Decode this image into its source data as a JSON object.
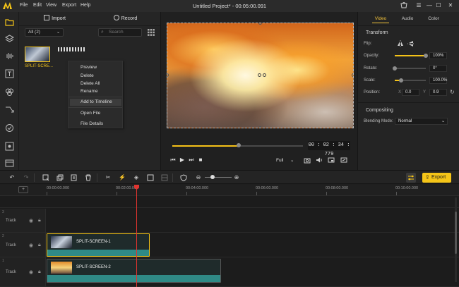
{
  "app": {
    "title": "Untitled Project* - 00:05:00.091",
    "menu": [
      "File",
      "Edit",
      "View",
      "Export",
      "Help"
    ]
  },
  "media_panel": {
    "import_label": "Import",
    "record_label": "Record",
    "filter_value": "All (2)",
    "search_placeholder": "Search",
    "item_label": "SPLIT-SCRE...",
    "context_menu": [
      "Preview",
      "Delete",
      "Delete All",
      "Rename",
      "Add to Timeline",
      "Open File",
      "File Details"
    ],
    "context_menu_highlight": "Add to Timeline"
  },
  "preview": {
    "timecode": "00 : 02 : 34 : 779",
    "progress": 0.51,
    "quality": "Full"
  },
  "properties": {
    "tabs": [
      "Video",
      "Audio",
      "Color"
    ],
    "active_tab": "Video",
    "transform_header": "Transform",
    "flip_label": "Flip:",
    "opacity_label": "Opacity:",
    "opacity_value": "100%",
    "opacity_level": 1.0,
    "rotate_label": "Rotate:",
    "rotate_value": "0°",
    "rotate_level": 0.0,
    "scale_label": "Scale:",
    "scale_value": "100.0%",
    "scale_level": 0.2,
    "position_label": "Position:",
    "pos_x_label": "X",
    "pos_x_value": "0.0",
    "pos_y_label": "Y",
    "pos_y_value": "0.9",
    "compositing_header": "Compositing",
    "blending_label": "Blending Mode:",
    "blending_value": "Normal"
  },
  "toolbar": {
    "export_label": "Export"
  },
  "timeline": {
    "ticks": [
      "00:00:00.000",
      "00:02:00.000",
      "00:04:00.000",
      "00:06:00.000",
      "00:08:00.000",
      "00:10:00.000"
    ],
    "tracks": [
      {
        "num": "3",
        "label": "Track"
      },
      {
        "num": "2",
        "label": "Track"
      },
      {
        "num": "1",
        "label": "Track"
      }
    ],
    "clips": [
      "SPLIT-SCREEN-1",
      "SPLIT-SCREEN-2"
    ]
  },
  "colors": {
    "accent": "#f5c518",
    "clip": "#2f8a86",
    "playhead": "#e0342f"
  }
}
